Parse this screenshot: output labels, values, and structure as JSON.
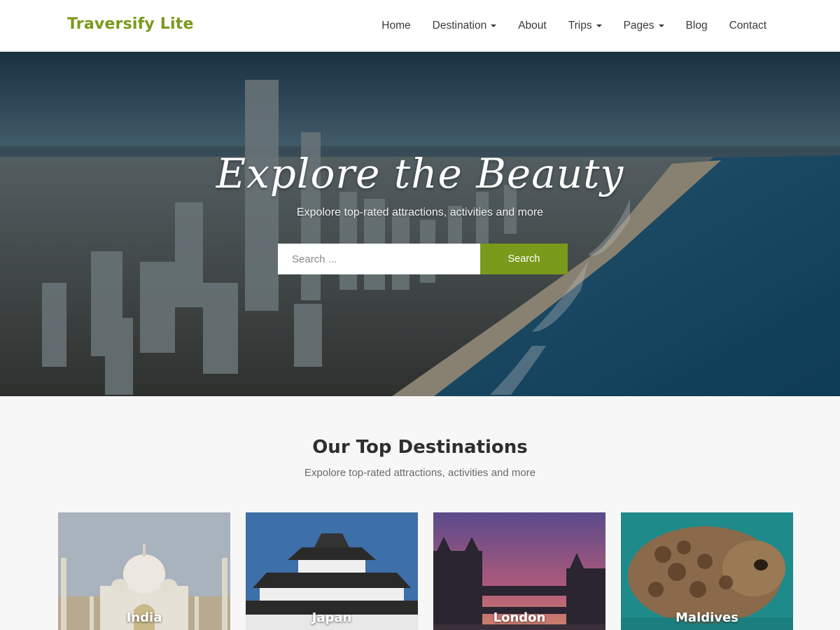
{
  "header": {
    "logo": "Traversify Lite",
    "nav": [
      {
        "label": "Home",
        "dropdown": false
      },
      {
        "label": "Destination",
        "dropdown": true
      },
      {
        "label": "About",
        "dropdown": false
      },
      {
        "label": "Trips",
        "dropdown": true
      },
      {
        "label": "Pages",
        "dropdown": true
      },
      {
        "label": "Blog",
        "dropdown": false
      },
      {
        "label": "Contact",
        "dropdown": false
      }
    ]
  },
  "hero": {
    "title": "Explore the Beauty",
    "subtitle": "Expolore top-rated attractions, activities and more",
    "search_placeholder": "Search ...",
    "search_button": "Search"
  },
  "destinations": {
    "title": "Our Top Destinations",
    "subtitle": "Expolore top-rated attractions, activities and more",
    "items": [
      {
        "label": "India"
      },
      {
        "label": "Japan"
      },
      {
        "label": "London"
      },
      {
        "label": "Maldives"
      }
    ]
  },
  "colors": {
    "accent": "#7a9a1b",
    "header_bg": "#ffffff",
    "page_bg": "#f7f7f7"
  }
}
